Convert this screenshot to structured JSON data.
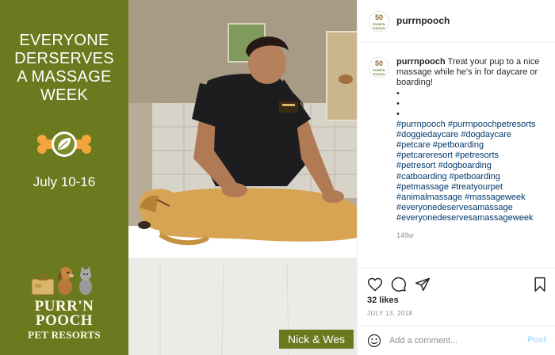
{
  "colors": {
    "promo_green": "#6b7a1f",
    "bone_orange": "#f2a53a",
    "leaf_circle": "#7d8d2c",
    "link_blue": "#00376b",
    "post_button_blue": "#b2dffc"
  },
  "promo": {
    "headline": [
      "EVERYONE",
      "DERSERVES",
      "A MASSAGE",
      "WEEK"
    ],
    "badge_icon": "bone-leaf-icon",
    "date": "July 10-16",
    "brand": {
      "line1": "PURR'N",
      "line2": "POOCH",
      "line3": "PET RESORTS"
    }
  },
  "photo": {
    "name_tag": "Nick & Wes",
    "shirt_logo_text": "PURR'N POOCH"
  },
  "post": {
    "header_username": "purrnpooch",
    "avatar_text": {
      "number": "50",
      "name": "PURR'N POOCH"
    },
    "caption": {
      "username": "purrnpooch",
      "text": "Treat your pup to a nice massage while he's in for daycare or boarding!",
      "bullets": [
        "•",
        "•",
        "•"
      ],
      "hashtags": [
        "#purrnpooch #purrnpoochpetresorts",
        "#doggiedaycare #dogdaycare",
        "#petcare #petboarding",
        "#petcareresort #petresorts",
        "#petresort #dogboarding",
        "#catboarding #petboarding",
        "#petmassage #treatyourpet",
        "#animalmassage #massageweek",
        "#everyonedeservesamassage",
        "#everyonedeservesamassageweek"
      ]
    },
    "time_ago": "149w",
    "icons": [
      "heart-icon",
      "comment-icon",
      "share-icon",
      "bookmark-icon"
    ],
    "likes": "32 likes",
    "date": "JULY 13, 2018",
    "comment_placeholder": "Add a comment...",
    "post_label": "Post"
  }
}
